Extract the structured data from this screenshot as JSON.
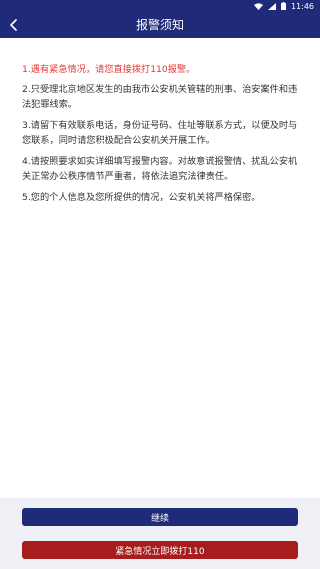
{
  "status_bar": {
    "time": "11:46",
    "icons": [
      "wifi-icon",
      "signal-icon",
      "battery-icon"
    ]
  },
  "header": {
    "title": "报警须知",
    "back_icon": "chevron-left-icon"
  },
  "content": {
    "items": [
      "1.遇有紧急情况，请您直接拨打110报警。",
      "2.只受理北京地区发生的由我市公安机关管辖的刑事、治安案件和违法犯罪线索。",
      "3.请留下有效联系电话，身份证号码、住址等联系方式，以便及时与您联系，同时请您积极配合公安机关开展工作。",
      "4.请按照要求如实详细填写报警内容。对故意谎报警情、扰乱公安机关正常办公秩序情节严重者，将依法追究法律责任。",
      "5.您的个人信息及您所提供的情况，公安机关将严格保密。"
    ]
  },
  "footer": {
    "continue_label": "继续",
    "call_label": "紧急情况立即拨打110"
  },
  "colors": {
    "primary": "#1f2a78",
    "danger": "#a71c1c",
    "urgent_text": "#e53935"
  }
}
